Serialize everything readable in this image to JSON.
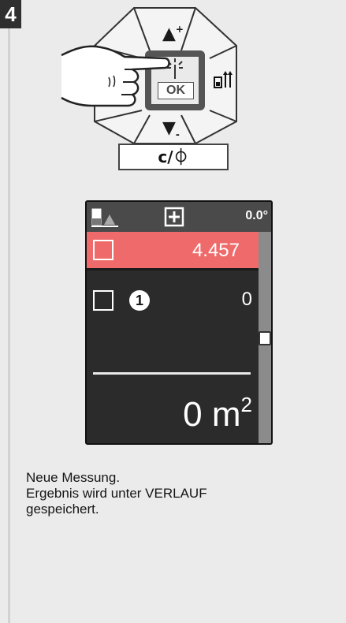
{
  "step": {
    "number": "4"
  },
  "keypad": {
    "up_key": {
      "symbol": "▲",
      "modifier": "+"
    },
    "down_key": {
      "symbol": "▼",
      "modifier": "-"
    },
    "ok_key": {
      "label": "OK",
      "icon": "laser-icon"
    },
    "right_key": {
      "icon": "reference-end-icon"
    },
    "clear_key": {
      "label": "c/⏀"
    },
    "hand": {
      "icon": "pointing-hand-icon"
    }
  },
  "screen": {
    "status": {
      "reference_icon": "reference-bottom-icon",
      "function_icon": "area-add-icon",
      "angle": "0.0°"
    },
    "rows": [
      {
        "value": "4.457",
        "highlighted": true,
        "color": "#ef6b6b"
      },
      {
        "value": "0",
        "marker": "1",
        "highlighted": false
      }
    ],
    "result": {
      "value": "0",
      "unit": "m",
      "exponent": "2"
    }
  },
  "description": {
    "lines": [
      "Neue Messung.",
      "Ergebnis wird unter VERLAUF",
      "gespeichert."
    ]
  }
}
